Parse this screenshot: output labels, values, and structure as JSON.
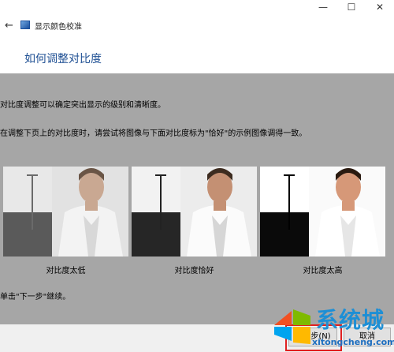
{
  "window": {
    "controls": {
      "minimize": "—",
      "maximize": "☐",
      "close": "✕"
    }
  },
  "header": {
    "back_icon": "←",
    "app_icon": "monitor-icon",
    "app_title": "显示颜色校准",
    "page_heading": "如何调整对比度"
  },
  "main": {
    "description_1": "对比度调整可以确定突出显示的级别和清晰度。",
    "description_2": "在调整下页上的对比度时，请尝试将图像与下面对比度标为\"恰好\"的示例图像调得一致。",
    "samples": [
      {
        "label": "对比度太低",
        "contrast": "low"
      },
      {
        "label": "对比度恰好",
        "contrast": "good"
      },
      {
        "label": "对比度太高",
        "contrast": "high"
      }
    ],
    "instruction": "单击\"下一步\"继续。"
  },
  "footer": {
    "next_label": "下一步(N)",
    "cancel_label": "取消"
  },
  "watermark": {
    "brand": "系统城",
    "url": "xitongcheng.com"
  },
  "colors": {
    "accent": "#1e4f93",
    "panel_gray": "#a6a6a6",
    "highlight_red": "#e02020",
    "watermark_blue": "#1e8fd5"
  }
}
